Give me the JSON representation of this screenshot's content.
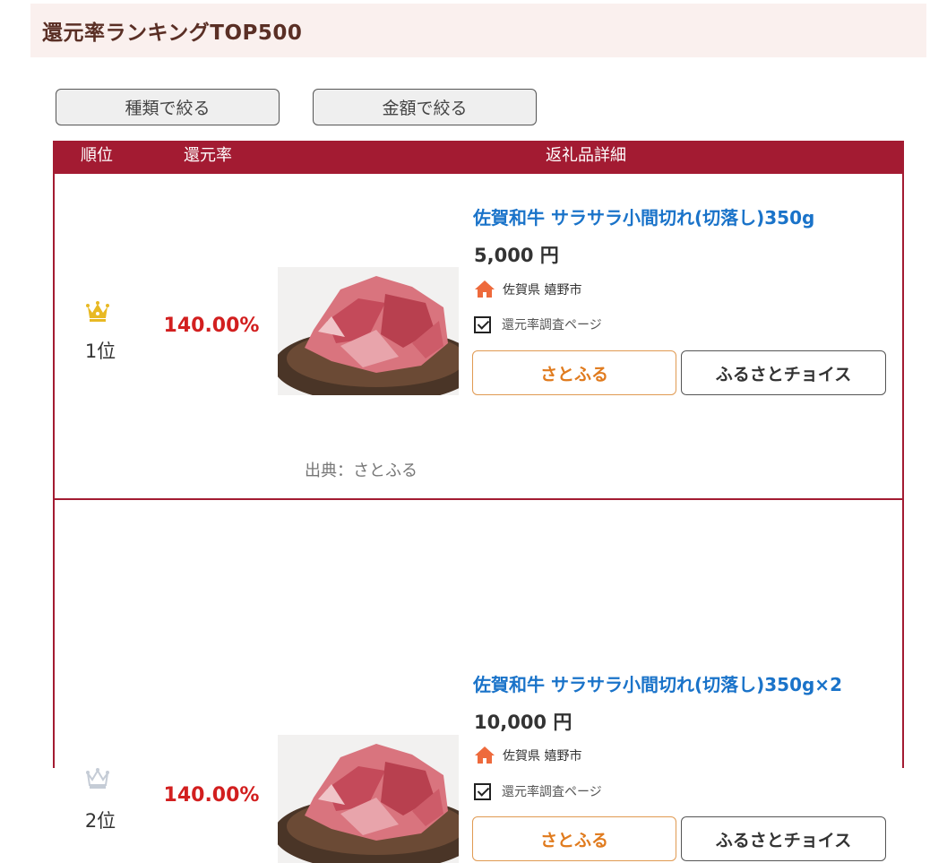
{
  "heading": "還元率ランキングTOP500",
  "filters": {
    "type_label": "種類で絞る",
    "amount_label": "金額で絞る"
  },
  "table_header": {
    "rank": "順位",
    "rate": "還元率",
    "detail": "返礼品詳細"
  },
  "rows": [
    {
      "rank": "1位",
      "crown_color": "#e8b923",
      "rate": "140.00%",
      "title": "佐賀和牛 サラサラ小間切れ(切落し)350g",
      "price": "5,000 円",
      "location": "佐賀県 嬉野市",
      "survey_label": "還元率調査ページ",
      "satofull_label": "さとふる",
      "choice_label": "ふるさとチョイス",
      "source": "出典：さとふる"
    },
    {
      "rank": "2位",
      "crown_color": "#c5ccd6",
      "rate": "140.00%",
      "title": "佐賀和牛 サラサラ小間切れ(切落し)350g×2",
      "price": "10,000 円",
      "location": "佐賀県 嬉野市",
      "survey_label": "還元率調査ページ",
      "satofull_label": "さとふる",
      "choice_label": "ふるさとチョイス"
    }
  ],
  "colors": {
    "accent": "#a31b32",
    "link": "#1a73c9",
    "rate": "#d21f1f",
    "satofull": "#e07b1e",
    "home_icon": "#ee6a3c"
  },
  "icons": {
    "crown": "crown-icon",
    "home": "home-icon",
    "check": "checkbox-icon"
  }
}
